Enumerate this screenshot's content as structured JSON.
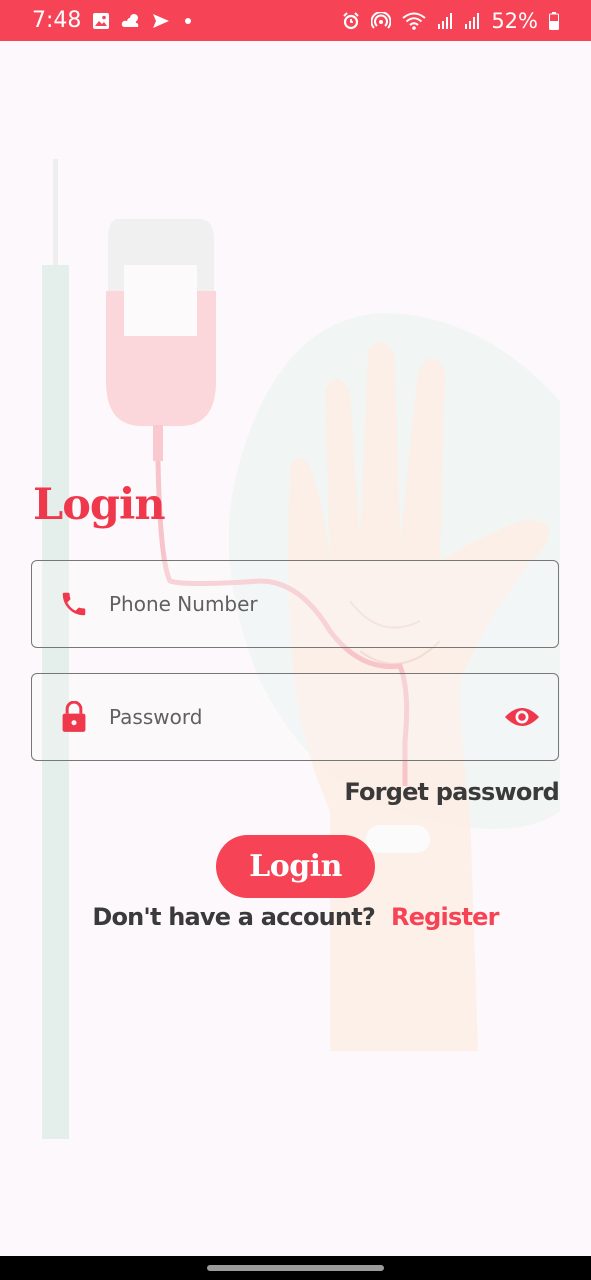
{
  "status_bar": {
    "time": "7:48",
    "battery": "52%",
    "left_icons": [
      "image-icon",
      "cloud-icon",
      "send-icon",
      "dot-icon"
    ],
    "right_icons": [
      "alarm-icon",
      "hotspot-icon",
      "wifi-icon",
      "signal-icon",
      "signal-icon",
      "battery-icon"
    ],
    "color": "#f64356"
  },
  "login": {
    "title": "Login",
    "phone_placeholder": "Phone Number",
    "password_placeholder": "Password",
    "forget_password": "Forget password",
    "login_button": "Login",
    "no_account_text": "Don't have a account?",
    "register_link": "Register"
  },
  "colors": {
    "accent": "#f64356",
    "background": "#fdf8fb",
    "text_dark": "#3a3a3a"
  }
}
